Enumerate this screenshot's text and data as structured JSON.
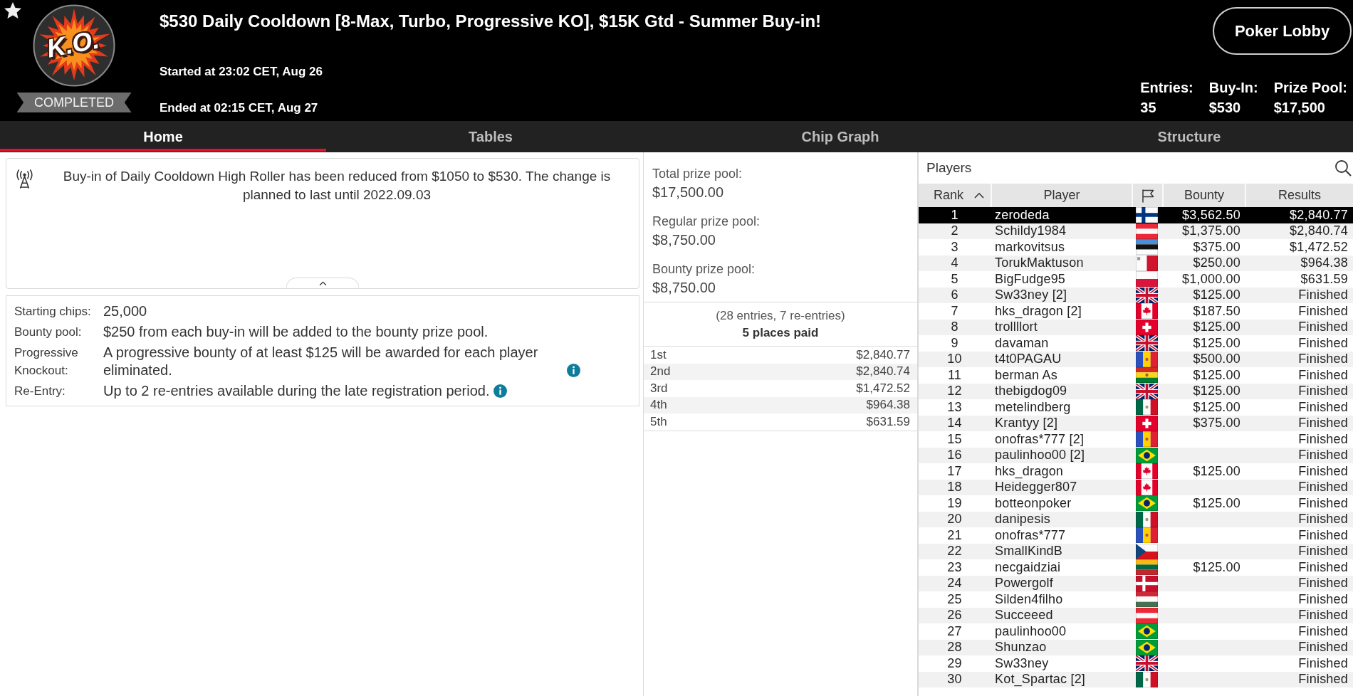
{
  "header": {
    "logo_text": "K.O.",
    "status": "COMPLETED",
    "title": "$530 Daily Cooldown [8-Max, Turbo, Progressive KO], $15K Gtd - Summer Buy-in!",
    "started": "Started at 23:02 CET, Aug 26",
    "ended": "Ended at 02:15 CET, Aug 27",
    "lobby_button": "Poker Lobby",
    "stats": [
      {
        "label": "Entries:",
        "value": "35"
      },
      {
        "label": "Buy-In:",
        "value": "$530"
      },
      {
        "label": "Prize Pool:",
        "value": "$17,500"
      }
    ]
  },
  "tabs": [
    {
      "label": "Home",
      "selected": true
    },
    {
      "label": "Tables",
      "selected": false
    },
    {
      "label": "Chip Graph",
      "selected": false
    },
    {
      "label": "Structure",
      "selected": false
    }
  ],
  "notice": {
    "text": "Buy-in of Daily Cooldown High Roller has been reduced from $1050 to $530. The change is planned to last until 2022.09.03",
    "expanded": true
  },
  "details": [
    {
      "label": "Starting chips:",
      "value": "25,000",
      "info": false
    },
    {
      "label": "Bounty pool:",
      "value": "$250 from each buy-in will be added to the bounty prize pool.",
      "info": false
    },
    {
      "label": "Progressive Knockout:",
      "value": "A progressive bounty of at least $125 will be awarded for each player eliminated.",
      "info": true
    },
    {
      "label": "Re-Entry:",
      "value": "Up to 2 re-entries available during the late registration period.",
      "info": true
    }
  ],
  "prize_pools": [
    {
      "label": "Total prize pool:",
      "value": "$17,500.00"
    },
    {
      "label": "Regular prize pool:",
      "value": "$8,750.00"
    },
    {
      "label": "Bounty prize pool:",
      "value": "$8,750.00"
    }
  ],
  "entries_note": "(28 entries, 7 re-entries)",
  "places_paid": "5 places paid",
  "payouts": [
    {
      "place": "1st",
      "amount": "$2,840.77"
    },
    {
      "place": "2nd",
      "amount": "$2,840.74"
    },
    {
      "place": "3rd",
      "amount": "$1,472.52"
    },
    {
      "place": "4th",
      "amount": "$964.38"
    },
    {
      "place": "5th",
      "amount": "$631.59"
    }
  ],
  "players": {
    "title": "Players",
    "columns": [
      {
        "kind": "text",
        "label": "Rank",
        "sorted": true
      },
      {
        "kind": "text",
        "label": "Player",
        "sorted": false
      },
      {
        "kind": "icon",
        "sorted": false
      },
      {
        "kind": "text",
        "label": "Bounty",
        "sorted": false
      },
      {
        "kind": "text",
        "label": "Results",
        "sorted": false
      }
    ],
    "rows": [
      {
        "rank": "1",
        "player": "zerodeda",
        "flag": {
          "kind": "finland"
        },
        "bounty": "$3,562.50",
        "result": "$2,840.77",
        "selected": true
      },
      {
        "rank": "2",
        "player": "Schildy1984",
        "flag": {
          "kind": "austria"
        },
        "bounty": "$1,375.00",
        "result": "$2,840.74",
        "selected": false
      },
      {
        "rank": "3",
        "player": "markovitsus",
        "flag": {
          "kind": "estonia"
        },
        "bounty": "$375.00",
        "result": "$1,472.52",
        "selected": false
      },
      {
        "rank": "4",
        "player": "TorukMaktuson",
        "flag": {
          "kind": "malta"
        },
        "bounty": "$250.00",
        "result": "$964.38",
        "selected": false
      },
      {
        "rank": "5",
        "player": "BigFudge95",
        "flag": {
          "kind": "poland"
        },
        "bounty": "$1,000.00",
        "result": "$631.59",
        "selected": false
      },
      {
        "rank": "6",
        "player": "Sw33ney [2]",
        "flag": {
          "kind": "uk"
        },
        "bounty": "$125.00",
        "result": "Finished",
        "selected": false
      },
      {
        "rank": "7",
        "player": "hks_dragon [2]",
        "flag": {
          "kind": "canada"
        },
        "bounty": "$187.50",
        "result": "Finished",
        "selected": false
      },
      {
        "rank": "8",
        "player": "trollllort",
        "flag": {
          "kind": "switzerland"
        },
        "bounty": "$125.00",
        "result": "Finished",
        "selected": false
      },
      {
        "rank": "9",
        "player": "davaman",
        "flag": {
          "kind": "uk"
        },
        "bounty": "$125.00",
        "result": "Finished",
        "selected": false
      },
      {
        "rank": "10",
        "player": "t4t0PAGAU",
        "flag": {
          "kind": "moldova"
        },
        "bounty": "$500.00",
        "result": "Finished",
        "selected": false
      },
      {
        "rank": "11",
        "player": "berman As",
        "flag": {
          "kind": "bolivia"
        },
        "bounty": "$125.00",
        "result": "Finished",
        "selected": false
      },
      {
        "rank": "12",
        "player": "thebigdog09",
        "flag": {
          "kind": "uk"
        },
        "bounty": "$125.00",
        "result": "Finished",
        "selected": false
      },
      {
        "rank": "13",
        "player": "metelindberg",
        "flag": {
          "kind": "mexico"
        },
        "bounty": "$125.00",
        "result": "Finished",
        "selected": false
      },
      {
        "rank": "14",
        "player": "Krantyy [2]",
        "flag": {
          "kind": "switzerland"
        },
        "bounty": "$375.00",
        "result": "Finished",
        "selected": false
      },
      {
        "rank": "15",
        "player": "onofras*777 [2]",
        "flag": {
          "kind": "moldova"
        },
        "result": "Finished",
        "selected": false
      },
      {
        "rank": "16",
        "player": "paulinhoo00 [2]",
        "flag": {
          "kind": "brazil"
        },
        "result": "Finished",
        "selected": false
      },
      {
        "rank": "17",
        "player": "hks_dragon",
        "flag": {
          "kind": "canada"
        },
        "bounty": "$125.00",
        "result": "Finished",
        "selected": false
      },
      {
        "rank": "18",
        "player": "Heidegger807",
        "flag": {
          "kind": "canada"
        },
        "result": "Finished",
        "selected": false
      },
      {
        "rank": "19",
        "player": "botteonpoker",
        "flag": {
          "kind": "brazil"
        },
        "bounty": "$125.00",
        "result": "Finished",
        "selected": false
      },
      {
        "rank": "20",
        "player": "danipesis",
        "flag": {
          "kind": "mexico"
        },
        "result": "Finished",
        "selected": false
      },
      {
        "rank": "21",
        "player": "onofras*777",
        "flag": {
          "kind": "moldova"
        },
        "result": "Finished",
        "selected": false
      },
      {
        "rank": "22",
        "player": "SmallKindB",
        "flag": {
          "kind": "czechia"
        },
        "result": "Finished",
        "selected": false
      },
      {
        "rank": "23",
        "player": "necgaidziai",
        "flag": {
          "kind": "lithuania"
        },
        "bounty": "$125.00",
        "result": "Finished",
        "selected": false
      },
      {
        "rank": "24",
        "player": "Powergolf",
        "flag": {
          "kind": "denmark"
        },
        "result": "Finished",
        "selected": false
      },
      {
        "rank": "25",
        "player": "Silden4filho",
        "flag": {
          "kind": "hungary"
        },
        "result": "Finished",
        "selected": false
      },
      {
        "rank": "26",
        "player": "Succeeed",
        "flag": {
          "kind": "austria"
        },
        "result": "Finished",
        "selected": false
      },
      {
        "rank": "27",
        "player": "paulinhoo00",
        "flag": {
          "kind": "brazil"
        },
        "result": "Finished",
        "selected": false
      },
      {
        "rank": "28",
        "player": "Shunzao",
        "flag": {
          "kind": "brazil"
        },
        "result": "Finished",
        "selected": false
      },
      {
        "rank": "29",
        "player": "Sw33ney",
        "flag": {
          "kind": "uk"
        },
        "result": "Finished",
        "selected": false
      },
      {
        "rank": "30",
        "player": "Kot_Spartac [2]",
        "flag": {
          "kind": "mexico"
        },
        "result": "Finished",
        "selected": false
      }
    ]
  }
}
